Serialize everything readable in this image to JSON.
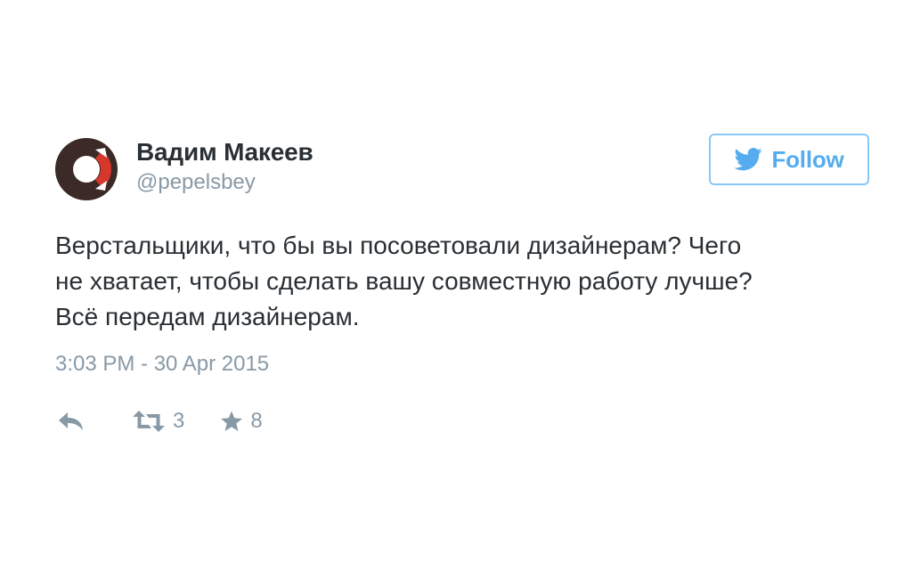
{
  "tweet": {
    "author": {
      "fullname": "Вадим Макеев",
      "screen_name": "@pepelsbey"
    },
    "follow_button": {
      "label": "Follow",
      "icon": "twitter-bird-icon",
      "color": "#55acee"
    },
    "text_lines": [
      "Верстальщики, что бы вы посоветовали дизайнерам? Чего",
      "не хватает, чтобы сделать вашу совместную работу лучше?",
      "Всё передам дизайнерам."
    ],
    "timestamp": "3:03 PM - 30 Apr 2015",
    "actions": {
      "reply": {
        "icon": "reply-icon"
      },
      "retweet": {
        "icon": "retweet-icon",
        "count": "3"
      },
      "favorite": {
        "icon": "star-icon",
        "count": "8"
      }
    },
    "colors": {
      "avatar_dark": "#3b2a26",
      "avatar_accent": "#d6392b",
      "muted_text": "#8899a6"
    }
  }
}
